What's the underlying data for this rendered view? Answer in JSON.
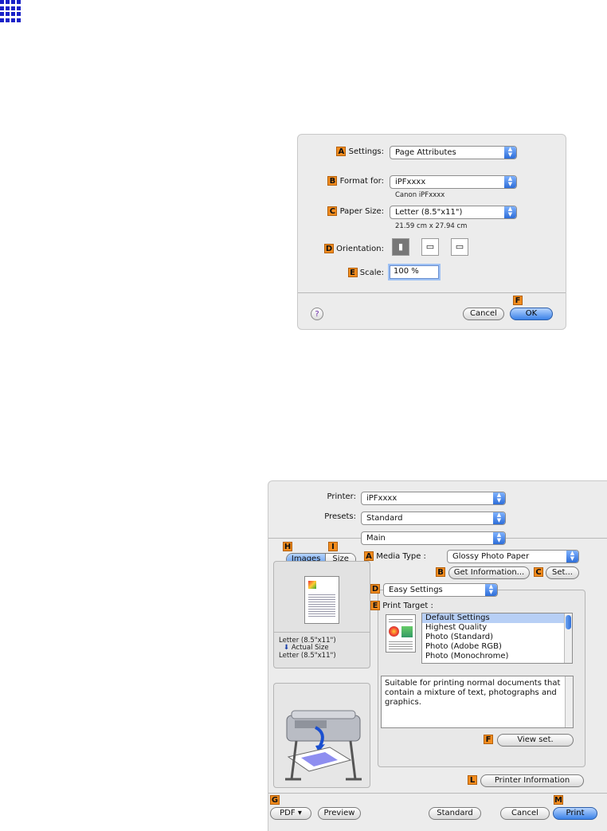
{
  "dialog1": {
    "settings_label": "Settings:",
    "settings_value": "Page Attributes",
    "format_label": "Format for:",
    "format_value": "iPFxxxx",
    "format_sub": "Canon iPFxxxx",
    "paper_label": "Paper Size:",
    "paper_value": "Letter (8.5\"x11\")",
    "paper_sub": "21.59 cm x 27.94 cm",
    "orientation_label": "Orientation:",
    "scale_label": "Scale:",
    "scale_value": "100 %",
    "help": "?",
    "cancel": "Cancel",
    "ok": "OK"
  },
  "dialog2": {
    "printer_label": "Printer:",
    "printer_value": "iPFxxxx",
    "presets_label": "Presets:",
    "presets_value": "Standard",
    "main_value": "Main",
    "tab_images": "Images",
    "tab_size": "Size",
    "media_type_label": "Media Type :",
    "media_type_value": "Glossy Photo Paper",
    "get_info": "Get Information...",
    "set": "Set...",
    "easy_settings": "Easy Settings",
    "print_target_label": "Print Target :",
    "print_targets": [
      "Default Settings",
      "Highest Quality",
      "Photo (Standard)",
      "Photo (Adobe RGB)",
      "Photo (Monochrome)"
    ],
    "description": "Suitable for printing normal documents that contain a mixture of text, photographs and graphics.",
    "view_set": "View set.",
    "printer_info": "Printer Information",
    "preview_line1": "Letter (8.5\"x11\")",
    "preview_line2": "Actual Size",
    "preview_line3": "Letter (8.5\"x11\")",
    "pdf": "PDF ▾",
    "preview": "Preview",
    "standard": "Standard",
    "cancel": "Cancel",
    "print": "Print"
  },
  "badges": {
    "A": "A",
    "B": "B",
    "C": "C",
    "D": "D",
    "E": "E",
    "F": "F",
    "G": "G",
    "H": "H",
    "I": "I",
    "L": "L",
    "M": "M"
  }
}
